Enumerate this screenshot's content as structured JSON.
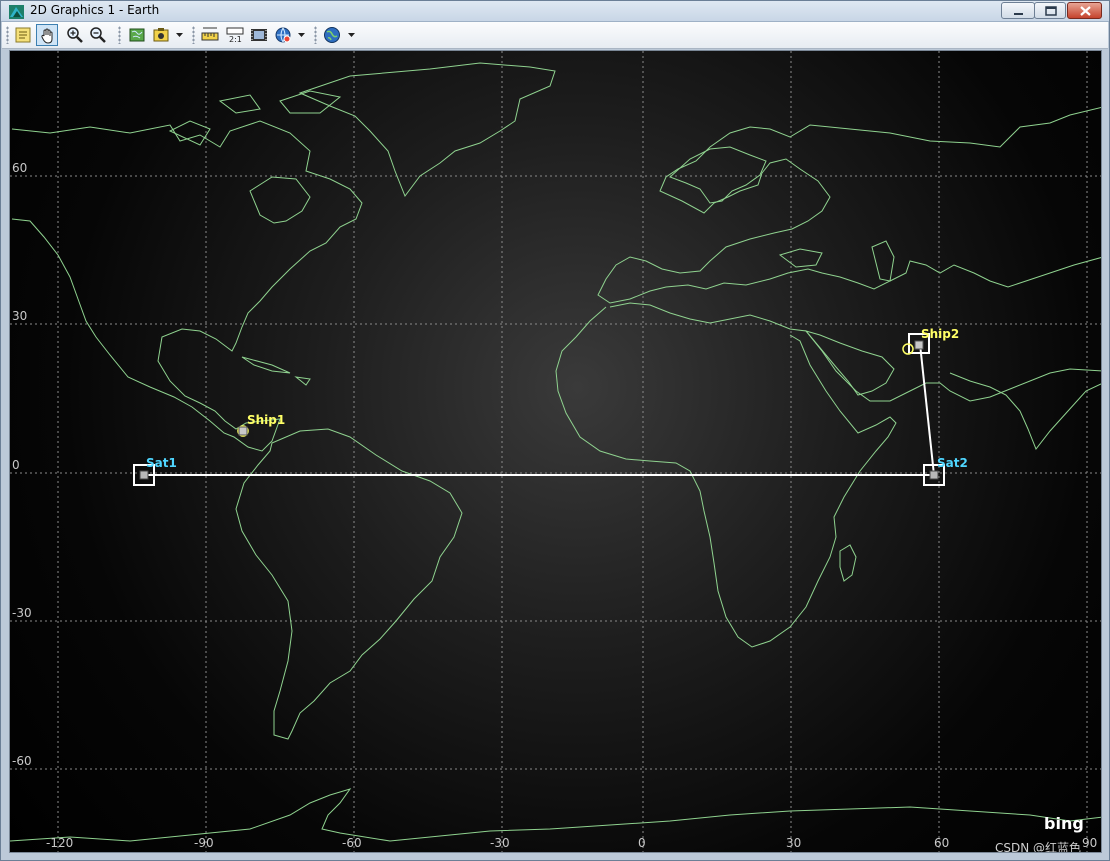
{
  "window": {
    "title": "2D Graphics 1 - Earth"
  },
  "toolbar": {
    "icons": [
      "properties-icon",
      "pan-icon",
      "zoom-in-icon",
      "zoom-out-icon",
      "map-icon",
      "snapshot-icon",
      "measure-icon",
      "scale-icon",
      "film-icon",
      "globe-link-icon",
      "globe-icon"
    ]
  },
  "map": {
    "lat_labels": [
      "60",
      "30",
      "0",
      "-30",
      "-60"
    ],
    "lon_labels": [
      "-120",
      "-90",
      "-60",
      "-30",
      "0",
      "30",
      "60",
      "90"
    ],
    "objects": {
      "sat1": {
        "label": "Sat1",
        "color": "#4fd6ff"
      },
      "sat2": {
        "label": "Sat2",
        "color": "#4fd6ff"
      },
      "ship1": {
        "label": "Ship1",
        "color": "#ffff66"
      },
      "ship2": {
        "label": "Ship2",
        "color": "#ffff66"
      }
    },
    "coastline_color": "#8fd28f",
    "grid_color": "#8a8a8a",
    "link_color": "#ffffff",
    "branding": "bing",
    "watermark": "CSDN @红蓝色"
  }
}
